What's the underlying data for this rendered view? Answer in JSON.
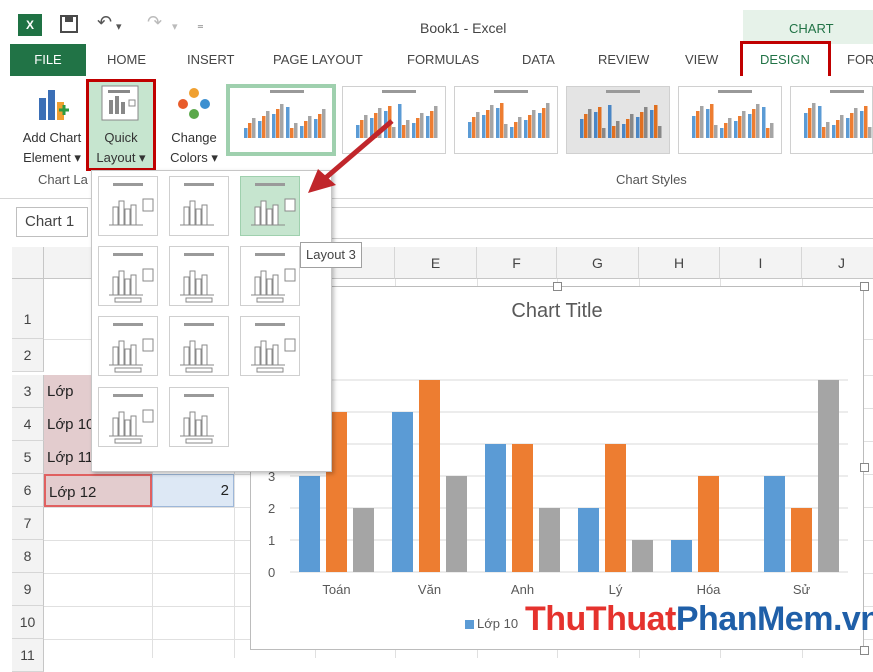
{
  "window": {
    "title": "Book1 - Excel",
    "app_badge": "X",
    "contextual_tab": "CHART TOOLS"
  },
  "ribbon_tabs": [
    "FILE",
    "HOME",
    "INSERT",
    "PAGE LAYOUT",
    "FORMULAS",
    "DATA",
    "REVIEW",
    "VIEW",
    "DESIGN",
    "FOR"
  ],
  "ribbon": {
    "add_chart_element": [
      "Add Chart",
      "Element ▾"
    ],
    "quick_layout": [
      "Quick",
      "Layout ▾"
    ],
    "change_colors": [
      "Change",
      "Colors ▾"
    ],
    "group_chart_layouts": "Chart La",
    "group_chart_styles": "Chart Styles"
  },
  "formula_bar": {
    "name_box": "Chart 1"
  },
  "tooltip": "Layout 3",
  "columns": [
    "E",
    "E",
    "F",
    "G",
    "H",
    "I",
    "J"
  ],
  "rows": [
    "1",
    "2",
    "3",
    "4",
    "5",
    "6",
    "7",
    "8",
    "9",
    "10",
    "11"
  ],
  "cells": {
    "a3": "Lớp",
    "a4": "Lớp 10",
    "a5": "Lớp 11",
    "a6": "Lớp 12",
    "b6": "2"
  },
  "chart_data": {
    "type": "bar",
    "title": "Chart Title",
    "categories": [
      "Toán",
      "Văn",
      "Anh",
      "Lý",
      "Hóa",
      "Sử"
    ],
    "series": [
      {
        "name": "Lớp 10",
        "color": "#5b9bd5",
        "values": [
          3,
          5,
          4,
          2,
          1,
          3
        ]
      },
      {
        "name": "",
        "color": "#ed7d31",
        "values": [
          5,
          6,
          4,
          4,
          3,
          2
        ]
      },
      {
        "name": "",
        "color": "#a5a5a5",
        "values": [
          2,
          3,
          2,
          1,
          0,
          6
        ]
      }
    ],
    "y_ticks": [
      "0",
      "1",
      "2",
      "3"
    ],
    "ylim": [
      0,
      6
    ],
    "legend": "bottom"
  },
  "watermark": {
    "part1": "ThuThuat",
    "part2": "PhanMem",
    "part3": ".vn"
  },
  "colors": {
    "excel_green": "#217346",
    "highlight_red": "#c00000"
  }
}
